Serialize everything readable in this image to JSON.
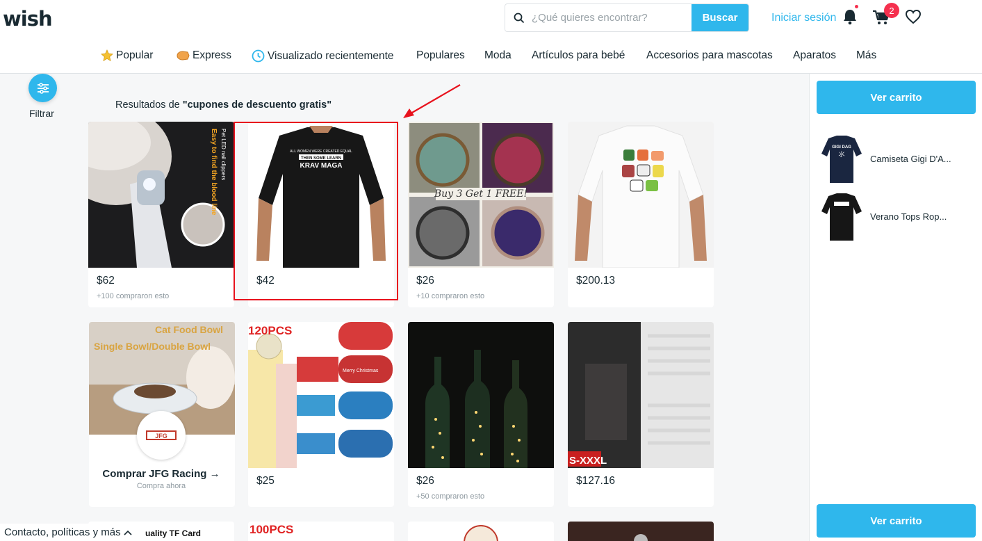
{
  "header": {
    "logo": "wish",
    "search_placeholder": "¿Qué quieres encontrar?",
    "search_button": "Buscar",
    "login": "Iniciar sesión",
    "cart_count": "2"
  },
  "nav": {
    "items": [
      {
        "label": "Popular",
        "icon": "star-icon"
      },
      {
        "label": "Express",
        "icon": "express-icon"
      },
      {
        "label": "Visualizado recientemente",
        "icon": "clock-icon"
      },
      {
        "label": "Populares"
      },
      {
        "label": "Moda"
      },
      {
        "label": "Artículos para bebé"
      },
      {
        "label": "Accesorios para mascotas"
      },
      {
        "label": "Aparatos"
      },
      {
        "label": "Más"
      }
    ]
  },
  "filter": {
    "label": "Filtrar"
  },
  "results": {
    "prefix": "Resultados de ",
    "query": "\"cupones de descuento gratis\""
  },
  "products": [
    {
      "price": "$62",
      "sold": "+100 compraron esto",
      "overlay1": "Easy to find the blood line",
      "overlay2": "Pet LED nail clippers"
    },
    {
      "price": "$42",
      "sold": "",
      "shirt_text1": "ALL WOMEN WERE CREATED EQUAL",
      "shirt_text2": "THEN SOME LEARN",
      "shirt_text3": "KRAV MAGA"
    },
    {
      "price": "$26",
      "sold": "+10 compraron esto",
      "overlay1": "Buy 3 Get 1 FREE!"
    },
    {
      "price": "$200.13",
      "sold": ""
    },
    {
      "store_name": "Comprar JFG Racing →",
      "store_sub": "Compra ahora",
      "overlay1": "Cat Food Bowl",
      "overlay2": "Single Bowl/Double Bowl",
      "logo_text": "JFG"
    },
    {
      "price": "$25",
      "sold": "",
      "overlay1": "120PCS",
      "overlay2": "Merry Christmas"
    },
    {
      "price": "$26",
      "sold": "+50 compraron esto"
    },
    {
      "price": "$127.16",
      "sold": "",
      "overlay1": "S-XXXL"
    }
  ],
  "partial_row": [
    "uality TF Card",
    "100PCS"
  ],
  "side": {
    "cart_button": "Ver carrito",
    "items": [
      {
        "name": "Camiseta Gigi D'A...",
        "shirt_text": "GIGI DAG"
      },
      {
        "name": "Verano Tops Rop..."
      }
    ]
  },
  "footer": {
    "link": "Contacto, políticas y más"
  },
  "colors": {
    "accent": "#2fb7ec",
    "badge": "#f5304e",
    "highlight": "#e8121d",
    "text": "#192a32"
  }
}
